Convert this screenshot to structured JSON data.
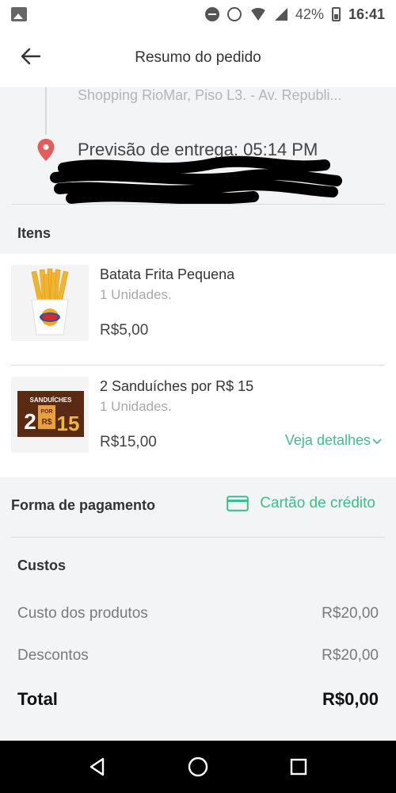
{
  "status_bar": {
    "battery": "42%",
    "time": "16:41"
  },
  "header": {
    "title": "Resumo do pedido"
  },
  "address": {
    "street": "Shopping RioMar, Piso L3. - Av. Republi...",
    "forecast": "Previsão de entrega: 05:14 PM"
  },
  "items_section": {
    "label": "Itens",
    "items": [
      {
        "name": "Batata Frita Pequena",
        "quantity": "1 Unidades.",
        "price": "R$5,00"
      },
      {
        "name": "2 Sanduíches por R$ 15",
        "quantity": "1 Unidades.",
        "price": "R$15,00",
        "details_link": "Veja detalhes",
        "thumb_text": [
          "SANDUÍCHES",
          "2",
          "POR",
          "R$",
          "15"
        ]
      }
    ]
  },
  "payment": {
    "label": "Forma de pagamento",
    "method": "Cartão de crédito"
  },
  "costs": {
    "label": "Custos",
    "rows": [
      {
        "label": "Custo dos produtos",
        "value": "R$20,00"
      },
      {
        "label": "Descontos",
        "value": "R$20,00"
      }
    ],
    "total": {
      "label": "Total",
      "value": "R$0,00"
    }
  },
  "colors": {
    "accent": "#3bbf8a",
    "pin": "#e85b5b",
    "background": "#f3f4f6"
  },
  "icons": [
    "gallery-icon",
    "do-not-disturb-icon",
    "alarm-icon",
    "wifi-icon",
    "signal-icon",
    "battery-icon",
    "back-arrow-icon",
    "location-pin-icon",
    "credit-card-icon",
    "chevron-down-icon",
    "nav-back-icon",
    "nav-home-icon",
    "nav-recents-icon"
  ]
}
